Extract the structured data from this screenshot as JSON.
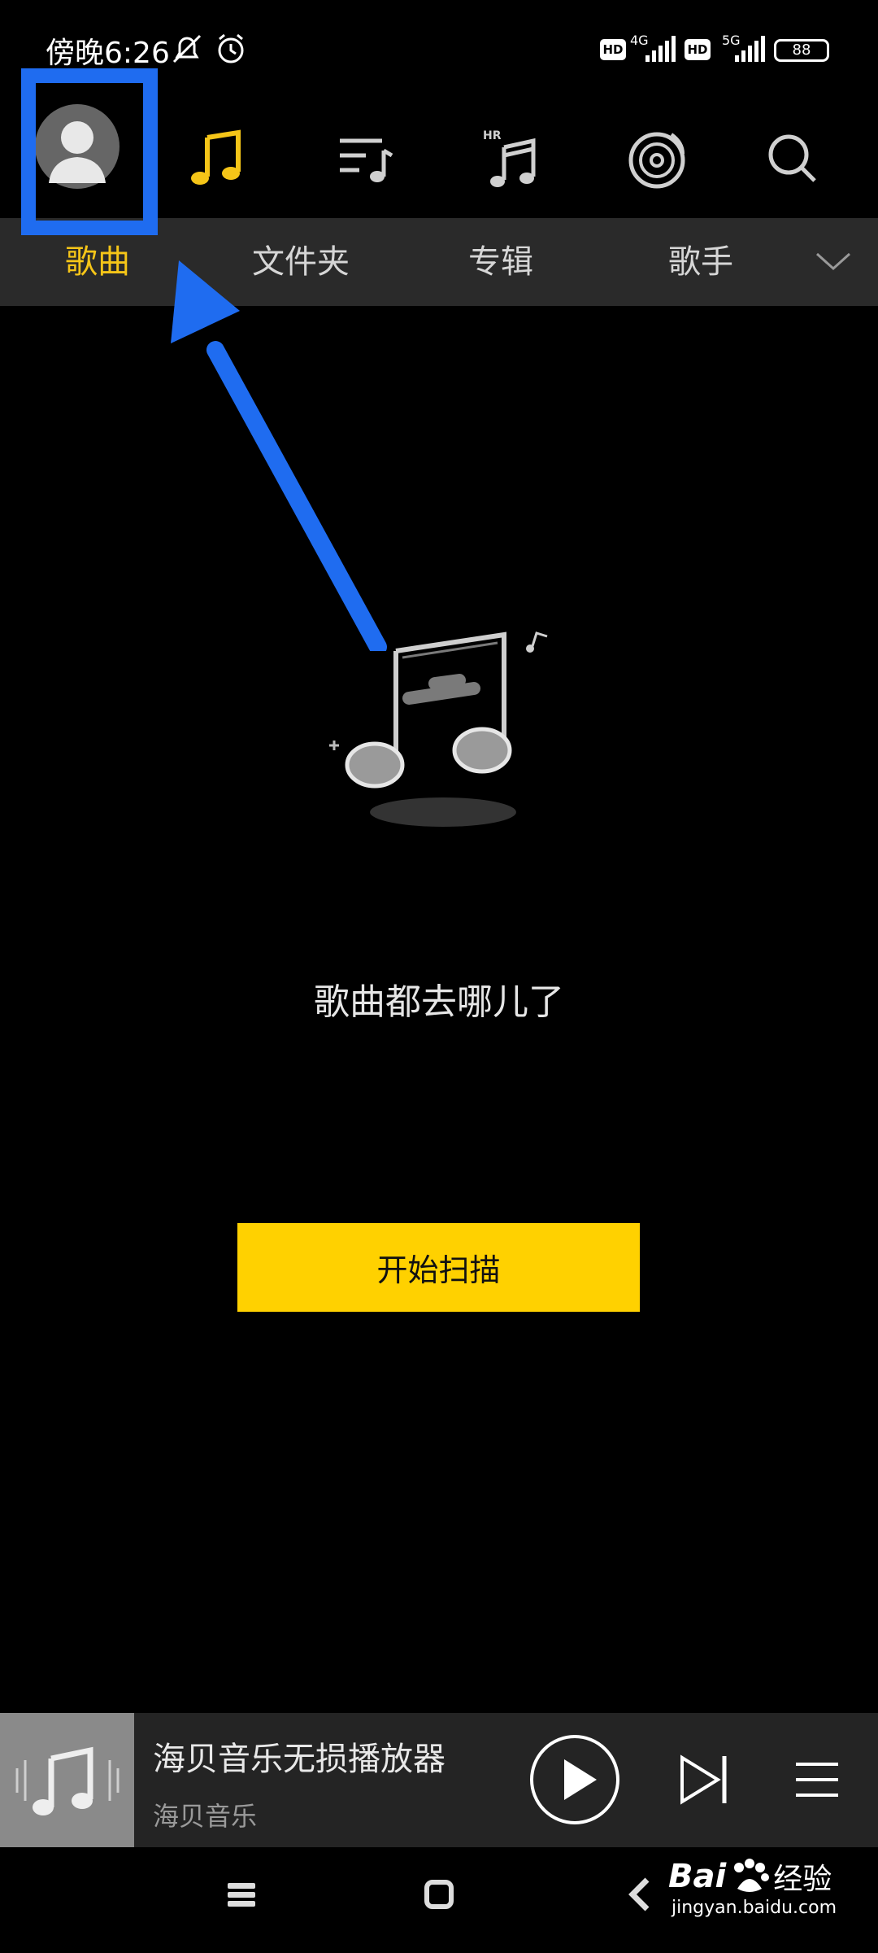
{
  "status_bar": {
    "time": "傍晚6:26",
    "net1": "4G",
    "net2": "5G",
    "hd": "HD",
    "battery": "88"
  },
  "top_nav": {
    "icons": [
      "avatar-icon",
      "music-note-icon",
      "playlist-icon",
      "hires-music-icon",
      "vinyl-disc-icon",
      "search-icon"
    ],
    "hr_label": "HR",
    "accent_color": "#f5c518"
  },
  "tabs": [
    {
      "label": "歌曲",
      "active": true
    },
    {
      "label": "文件夹",
      "active": false
    },
    {
      "label": "专辑",
      "active": false
    },
    {
      "label": "歌手",
      "active": false
    }
  ],
  "empty_state": {
    "message": "歌曲都去哪儿了",
    "button": "开始扫描",
    "button_color": "#ffd100"
  },
  "player": {
    "title": "海贝音乐无损播放器",
    "artist": "海贝音乐"
  },
  "watermark": {
    "brand": "Bai",
    "brand2": "经验",
    "url": "jingyan.baidu.com"
  },
  "annotation_color": "#1f6cf0"
}
